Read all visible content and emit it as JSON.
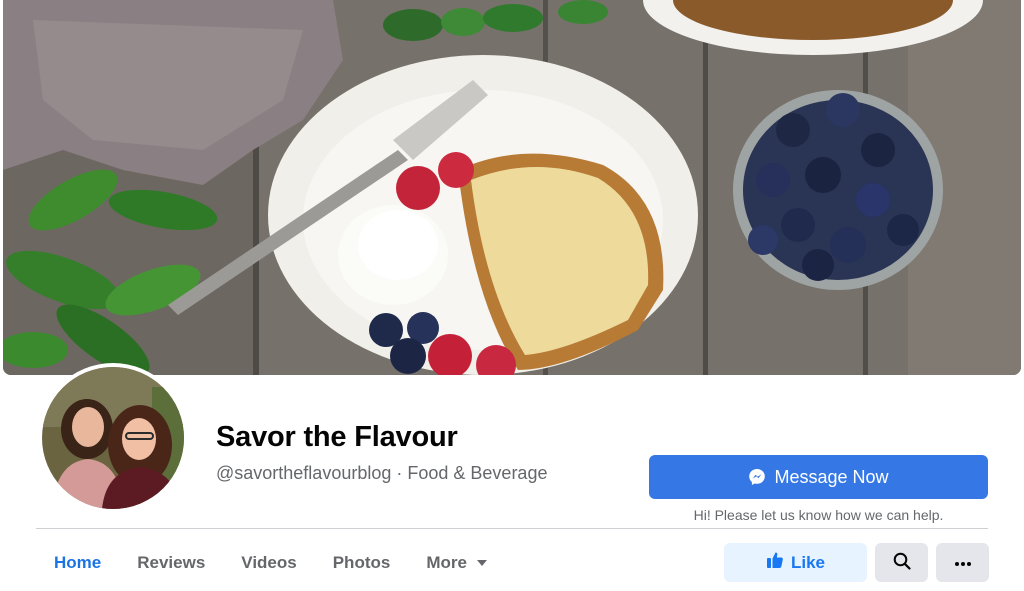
{
  "page": {
    "name": "Savor the Flavour",
    "handle": "@savortheflavourblog",
    "separator": " · ",
    "category": "Food & Beverage"
  },
  "cta": {
    "message_label": "Message Now",
    "message_icon": "messenger-icon",
    "hint": "Hi! Please let us know how we can help."
  },
  "tabs": [
    {
      "label": "Home",
      "active": true
    },
    {
      "label": "Reviews",
      "active": false
    },
    {
      "label": "Videos",
      "active": false
    },
    {
      "label": "Photos",
      "active": false
    },
    {
      "label": "More",
      "active": false,
      "icon": "caret-down-icon"
    }
  ],
  "actions": {
    "like_label": "Like",
    "like_icon": "thumbs-up-icon",
    "search_icon": "search-icon",
    "more_icon": "ellipsis-icon"
  },
  "colors": {
    "accent": "#1877f2",
    "cta_background": "#3578e5",
    "like_background": "#e7f3ff",
    "secondary_text": "#65676b",
    "button_gray": "#e4e6eb"
  }
}
